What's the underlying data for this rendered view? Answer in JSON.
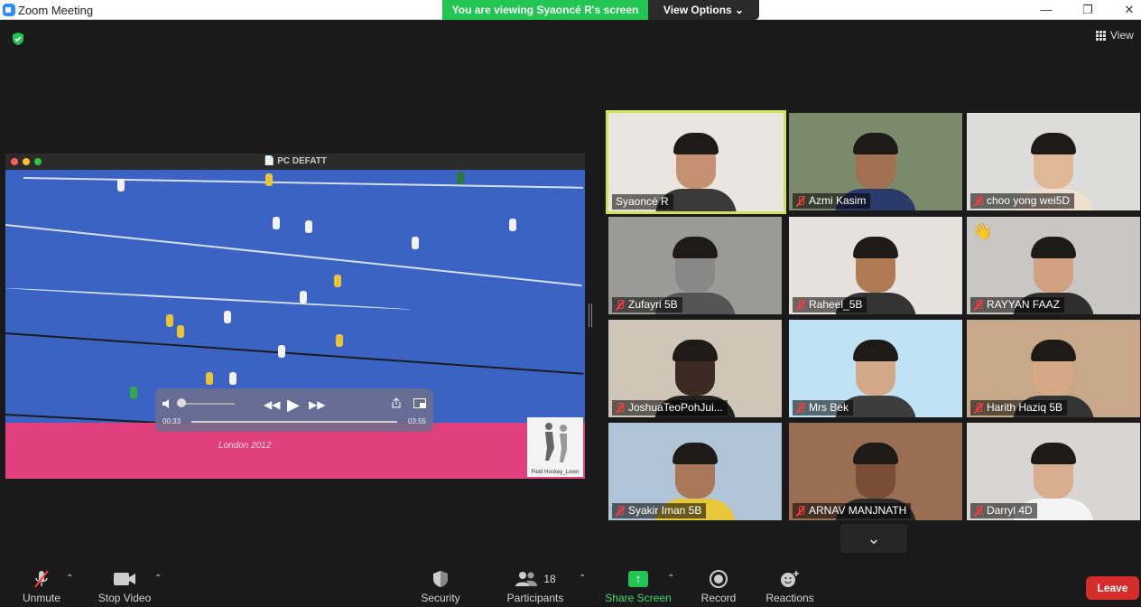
{
  "window": {
    "title": "Zoom Meeting",
    "minimize": "—",
    "restore": "❐",
    "close": "✕"
  },
  "banner": {
    "viewing_text": "You are viewing Syaoncé R's screen",
    "view_options": "View Options ⌄"
  },
  "top_right": {
    "view_label": "View"
  },
  "shared_screen": {
    "window_title": "📄 PC DEFATT",
    "time_elapsed": "00:33",
    "time_total": "03:55",
    "logo_caption": "Field Hockey_Lover",
    "watermark": "London 2012"
  },
  "participants": [
    {
      "name": "Syaoncé R",
      "active": true,
      "muted": false,
      "bg": "#e8e6e1",
      "shirt": "#3a3a3a",
      "face": "#c49070"
    },
    {
      "name": "Azmi Kasim",
      "active": false,
      "muted": true,
      "bg": "#7a8a6a",
      "shirt": "#2a3a6a",
      "face": "#a07050"
    },
    {
      "name": "choo yong wei5D",
      "active": false,
      "muted": true,
      "bg": "#dcdcda",
      "shirt": "#f0e0d0",
      "face": "#e0b898"
    },
    {
      "name": "Zufayri 5B",
      "active": false,
      "muted": true,
      "bg": "#9a9a98",
      "shirt": "#555",
      "face": "#888"
    },
    {
      "name": "Raheel_5B",
      "active": false,
      "muted": true,
      "bg": "#e6e1dc",
      "shirt": "#333",
      "face": "#b07a55"
    },
    {
      "name": "RAYYAN FAAZ",
      "active": false,
      "muted": true,
      "bg": "#c9c7c4",
      "shirt": "#2e2e2e",
      "face": "#d0a080",
      "raised_hand": "👋"
    },
    {
      "name": "JoshuaTeoPohJui...",
      "active": false,
      "muted": true,
      "bg": "#cfc6b8",
      "shirt": "#222",
      "face": "#3a2a22"
    },
    {
      "name": "Mrs Bek",
      "active": false,
      "muted": true,
      "bg": "#bfe3f5",
      "shirt": "#3d3d3d",
      "face": "#d2a888"
    },
    {
      "name": "Harith Haziq 5B",
      "active": false,
      "muted": true,
      "bg": "#c7a888",
      "shirt": "#333",
      "face": "#d7a886"
    },
    {
      "name": "Syakir Iman 5B",
      "active": false,
      "muted": true,
      "bg": "#b0c4d8",
      "shirt": "#e8c73a",
      "face": "#a87858"
    },
    {
      "name": "ARNAV MANJNATH",
      "active": false,
      "muted": true,
      "bg": "#9a6e52",
      "shirt": "#2a2a2a",
      "face": "#7a4e36"
    },
    {
      "name": "Darryl 4D",
      "active": false,
      "muted": true,
      "bg": "#d8d6d2",
      "shirt": "#f4f4f4",
      "face": "#d8ae8e"
    }
  ],
  "toolbar": {
    "unmute": "Unmute",
    "stop_video": "Stop Video",
    "security": "Security",
    "participants": "Participants",
    "participants_count": "18",
    "share_screen": "Share Screen",
    "record": "Record",
    "reactions": "Reactions",
    "leave": "Leave"
  },
  "colors": {
    "banner_green": "#23c552",
    "active_speaker_border": "#d4e157",
    "leave_red": "#d72c2c",
    "field_blue": "#3b63c4",
    "pitch_pink": "#e0407e"
  }
}
